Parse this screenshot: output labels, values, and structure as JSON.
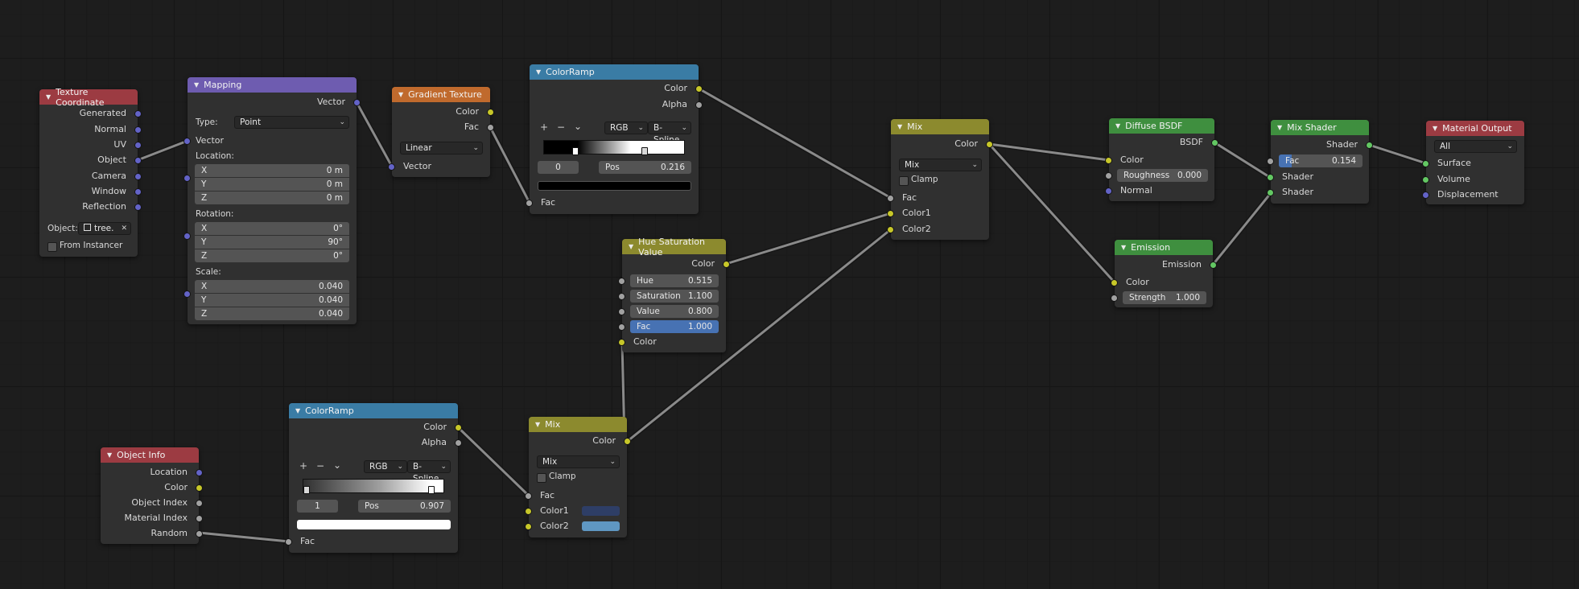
{
  "colors": {
    "accent_field": "#4772b3",
    "texture_header": "#9c3b42",
    "vector_header": "#6e5cb0",
    "converter_header": "#3a7ca5",
    "shader_header": "#3f8f3f",
    "output_header": "#9c3b42",
    "color_header": "#8c8a2e",
    "gradient_header": "#c06a2d"
  },
  "nodes": {
    "texcoord": {
      "title": "Texture Coordinate",
      "outputs": [
        "Generated",
        "Normal",
        "UV",
        "Object",
        "Camera",
        "Window",
        "Reflection"
      ],
      "object_label": "Object:",
      "object_value": "tree.",
      "from_instancer": "From Instancer"
    },
    "mapping": {
      "title": "Mapping",
      "out_vector": "Vector",
      "type_label": "Type:",
      "type_value": "Point",
      "in_vector": "Vector",
      "location_label": "Location:",
      "location": [
        {
          "axis": "X",
          "value": "0 m"
        },
        {
          "axis": "Y",
          "value": "0 m"
        },
        {
          "axis": "Z",
          "value": "0 m"
        }
      ],
      "rotation_label": "Rotation:",
      "rotation": [
        {
          "axis": "X",
          "value": "0°"
        },
        {
          "axis": "Y",
          "value": "90°"
        },
        {
          "axis": "Z",
          "value": "0°"
        }
      ],
      "scale_label": "Scale:",
      "scale": [
        {
          "axis": "X",
          "value": "0.040"
        },
        {
          "axis": "Y",
          "value": "0.040"
        },
        {
          "axis": "Z",
          "value": "0.040"
        }
      ]
    },
    "gradient": {
      "title": "Gradient Texture",
      "out_color": "Color",
      "out_fac": "Fac",
      "type_value": "Linear",
      "in_vector": "Vector"
    },
    "ramp1": {
      "title": "ColorRamp",
      "out_color": "Color",
      "out_alpha": "Alpha",
      "add": "+",
      "remove": "−",
      "menu": "⌄",
      "mode": "RGB",
      "interp": "B-Spline",
      "index": "0",
      "pos_label": "Pos",
      "pos_value": "0.216",
      "in_fac": "Fac"
    },
    "mix1": {
      "title": "Mix",
      "out_color": "Color",
      "blend": "Mix",
      "clamp": "Clamp",
      "in_fac": "Fac",
      "in_color1": "Color1",
      "in_color2": "Color2"
    },
    "huesat": {
      "title": "Hue Saturation Value",
      "out_color": "Color",
      "hue_label": "Hue",
      "hue": "0.515",
      "sat_label": "Saturation",
      "sat": "1.100",
      "val_label": "Value",
      "val": "0.800",
      "fac_label": "Fac",
      "fac": "1.000",
      "in_color": "Color"
    },
    "diffuse": {
      "title": "Diffuse BSDF",
      "out_bsdf": "BSDF",
      "in_color": "Color",
      "rough_label": "Roughness",
      "rough": "0.000",
      "in_normal": "Normal"
    },
    "emission": {
      "title": "Emission",
      "out_emission": "Emission",
      "in_color": "Color",
      "strength_label": "Strength",
      "strength": "1.000"
    },
    "mixshader": {
      "title": "Mix Shader",
      "out_shader": "Shader",
      "fac_label": "Fac",
      "fac": "0.154",
      "in_shader1": "Shader",
      "in_shader2": "Shader"
    },
    "matout": {
      "title": "Material Output",
      "target": "All",
      "in_surface": "Surface",
      "in_volume": "Volume",
      "in_disp": "Displacement"
    },
    "objinfo": {
      "title": "Object Info",
      "outputs": [
        "Location",
        "Color",
        "Object Index",
        "Material Index",
        "Random"
      ]
    },
    "ramp2": {
      "title": "ColorRamp",
      "out_color": "Color",
      "out_alpha": "Alpha",
      "add": "+",
      "remove": "−",
      "menu": "⌄",
      "mode": "RGB",
      "interp": "B-Spline",
      "index": "1",
      "pos_label": "Pos",
      "pos_value": "0.907",
      "in_fac": "Fac"
    },
    "mix2": {
      "title": "Mix",
      "out_color": "Color",
      "blend": "Mix",
      "clamp": "Clamp",
      "in_fac": "Fac",
      "in_color1": "Color1",
      "in_color2": "Color2",
      "color1": "#2e3e66",
      "color2": "#5f97c2"
    }
  }
}
